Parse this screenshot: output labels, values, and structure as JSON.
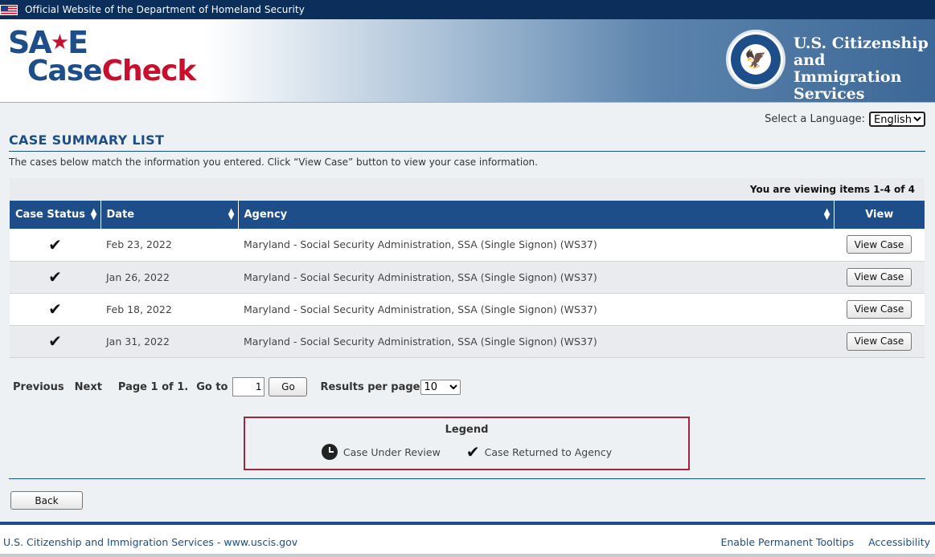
{
  "topbar": {
    "text": "Official Website of the Department of Homeland Security"
  },
  "header": {
    "logo_save": "SA",
    "logo_save_star": "★",
    "logo_save_end": "E",
    "logo_case": "Case",
    "logo_check": "Check",
    "agency_line1": "U.S. Citizenship",
    "agency_line2": "and Immigration",
    "agency_line3": "Services",
    "seal_icon": "eagle-seal-icon"
  },
  "language": {
    "label": "Select a Language:",
    "selected": "English"
  },
  "page": {
    "title": "CASE SUMMARY LIST",
    "intro": "The cases below match the information you entered. Click “View Case” button to view your case information."
  },
  "table": {
    "viewing": "You are viewing items 1-4 of 4",
    "headers": {
      "status": "Case Status",
      "date": "Date",
      "agency": "Agency",
      "view": "View"
    },
    "rows": [
      {
        "status_icon": "✔",
        "date": "Feb 23, 2022",
        "agency": "Maryland - Social Security Administration, SSA (Single Signon) (WS37)",
        "button": "View Case"
      },
      {
        "status_icon": "✔",
        "date": "Jan 26, 2022",
        "agency": "Maryland - Social Security Administration, SSA (Single Signon) (WS37)",
        "button": "View Case"
      },
      {
        "status_icon": "✔",
        "date": "Feb 18, 2022",
        "agency": "Maryland - Social Security Administration, SSA (Single Signon) (WS37)",
        "button": "View Case"
      },
      {
        "status_icon": "✔",
        "date": "Jan 31, 2022",
        "agency": "Maryland - Social Security Administration, SSA (Single Signon) (WS37)",
        "button": "View Case"
      }
    ]
  },
  "pager": {
    "previous": "Previous",
    "next": "Next",
    "page_info": "Page 1 of 1.",
    "goto": "Go to",
    "goto_value": "1",
    "go_button": "Go",
    "results_label": "Results per page",
    "results_value": "10"
  },
  "legend": {
    "title": "Legend",
    "review": "Case Under Review",
    "returned": "Case Returned to Agency",
    "check_glyph": "✔"
  },
  "back_button": "Back",
  "footer": {
    "left": "U.S. Citizenship and Immigration Services - www.uscis.gov",
    "tooltips": "Enable Permanent Tooltips",
    "accessibility": "Accessibility"
  },
  "colors": {
    "brand_blue": "#1d4e89",
    "brand_red": "#c8102e",
    "legend_border": "#a0263f"
  }
}
